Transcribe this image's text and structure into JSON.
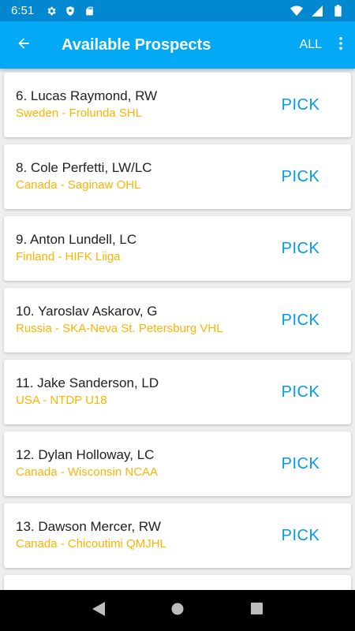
{
  "status_bar": {
    "time": "6:51",
    "left_icons": [
      "gear-icon",
      "shield-icon",
      "sd-card-icon"
    ],
    "right_icons": [
      "wifi-icon",
      "signal-icon",
      "battery-icon"
    ]
  },
  "app_bar": {
    "title": "Available Prospects",
    "filter_label": "ALL",
    "back_icon": "back-arrow-icon",
    "menu_icon": "more-vert-icon"
  },
  "prospects": [
    {
      "name": "6. Lucas Raymond, RW",
      "team": "Sweden - Frolunda SHL",
      "action": "PICK"
    },
    {
      "name": "8. Cole Perfetti, LW/LC",
      "team": "Canada - Saginaw OHL",
      "action": "PICK"
    },
    {
      "name": "9. Anton Lundell, LC",
      "team": "Finland - HIFK Liiga",
      "action": "PICK"
    },
    {
      "name": "10. Yaroslav Askarov, G",
      "team": "Russia - SKA-Neva St. Petersburg VHL",
      "action": "PICK"
    },
    {
      "name": "11. Jake Sanderson, LD",
      "team": "USA - NTDP U18",
      "action": "PICK"
    },
    {
      "name": "12. Dylan Holloway, LC",
      "team": "Canada - Wisconsin NCAA",
      "action": "PICK"
    },
    {
      "name": "13. Dawson Mercer, RW",
      "team": "Canada - Chicoutimi QMJHL",
      "action": "PICK"
    },
    {
      "name": "",
      "team": "",
      "action": ""
    }
  ],
  "nav_bar": {
    "icons": [
      "nav-back-icon",
      "nav-home-icon",
      "nav-recents-icon"
    ]
  },
  "colors": {
    "status_bar": "#0288d1",
    "app_bar": "#03a9f4",
    "team_text": "#ffb300",
    "pick_text": "#039be5",
    "background": "#eeeeee"
  }
}
